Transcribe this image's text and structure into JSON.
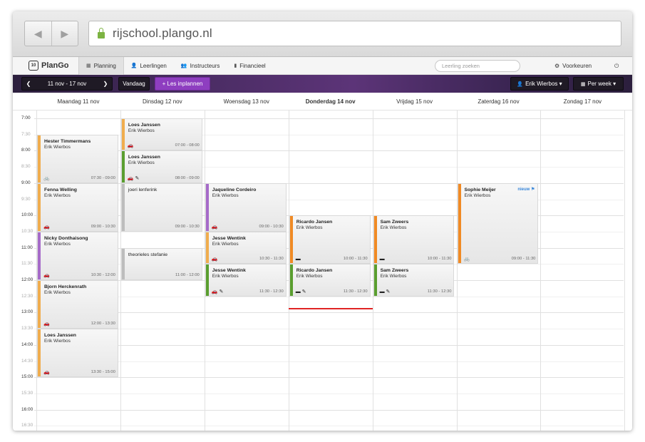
{
  "browser": {
    "url": "rijschool.plango.nl",
    "back_icon": "◀",
    "forward_icon": "▶"
  },
  "app": {
    "logo": "PlanGo",
    "logo_icon_text": "10",
    "nav": [
      {
        "label": "Planning",
        "icon": "calendar-icon",
        "glyph": "▦"
      },
      {
        "label": "Leerlingen",
        "icon": "user-icon",
        "glyph": "👤"
      },
      {
        "label": "Instructeurs",
        "icon": "users-icon",
        "glyph": "👥"
      },
      {
        "label": "Financieel",
        "icon": "document-icon",
        "glyph": "▮"
      }
    ],
    "search_placeholder": "Leerling zoeken",
    "prefs_label": "Voorkeuren",
    "power_icon": "⏻"
  },
  "toolbar": {
    "date_range": "11 nov - 17 nov",
    "prev": "❮",
    "next": "❯",
    "today": "Vandaag",
    "plan_button": "+ Les inplannen",
    "instructor": "Erik Wierbos ▾",
    "view": "Per week ▾",
    "accent": "#8e3ec0"
  },
  "days": [
    "Maandag 11 nov",
    "Dinsdag 12 nov",
    "Woensdag 13 nov",
    "Donderdag 14 nov",
    "Vrijdag 15 nov",
    "Zaterdag 16 nov",
    "Zondag 17 nov"
  ],
  "today_index": 3,
  "times": [
    "7:00",
    "7:30",
    "8:00",
    "8:30",
    "9:00",
    "9:30",
    "10:00",
    "10:30",
    "11:00",
    "11:30",
    "12:00",
    "12:30",
    "13:00",
    "13:30",
    "14:00",
    "14:30",
    "15:00",
    "15:30",
    "16:00",
    "16:30"
  ],
  "events": [
    {
      "day": 0,
      "start": 7.5,
      "end": 9.0,
      "name": "Hester Timmermans",
      "instructor": "Erik Wierbos",
      "time": "07:30 - 09:00",
      "color": "#f0ad4e",
      "icons": "🚲"
    },
    {
      "day": 0,
      "start": 9.0,
      "end": 10.5,
      "name": "Fenna Welling",
      "instructor": "Erik Wierbos",
      "time": "09:00 - 10:30",
      "color": "#f0ad4e",
      "icons": "🚗"
    },
    {
      "day": 0,
      "start": 10.5,
      "end": 12.0,
      "name": "Nicky Donthaisong",
      "instructor": "Erik Wierbos",
      "time": "10:30 - 12:00",
      "color": "#a66bc9",
      "icons": "🚗"
    },
    {
      "day": 0,
      "start": 12.0,
      "end": 13.5,
      "name": "Bjorn Herckenrath",
      "instructor": "Erik Wierbos",
      "time": "12:00 - 13:30",
      "color": "#f0ad4e",
      "icons": "🚗"
    },
    {
      "day": 0,
      "start": 13.5,
      "end": 15.0,
      "name": "Loes Janssen",
      "instructor": "Erik Wierbos",
      "time": "13:30 - 15:00",
      "color": "#f0ad4e",
      "icons": "🚗"
    },
    {
      "day": 1,
      "start": 7.0,
      "end": 8.0,
      "name": "Loes Janssen",
      "instructor": "Erik Wierbos",
      "time": "07:00 - 08:00",
      "color": "#f0ad4e",
      "icons": "🚗"
    },
    {
      "day": 1,
      "start": 8.0,
      "end": 9.0,
      "name": "Loes Janssen",
      "instructor": "Erik Wierbos",
      "time": "08:00 - 09:00",
      "color": "#5a9e2f",
      "icons": "🚗 ✎"
    },
    {
      "day": 1,
      "start": 9.0,
      "end": 10.5,
      "name": "joeri lenferink",
      "instructor": "",
      "time": "09:00 - 10:30",
      "color": "#bdbdbd",
      "icons": "",
      "plain": true
    },
    {
      "day": 1,
      "start": 11.0,
      "end": 12.0,
      "name": "theorieles stefanie",
      "instructor": "",
      "time": "11:00 - 12:00",
      "color": "#bdbdbd",
      "icons": "",
      "plain": true
    },
    {
      "day": 2,
      "start": 9.0,
      "end": 10.5,
      "name": "Jaqueline Cordeiro",
      "instructor": "Erik Wierbos",
      "time": "09:00 - 10:30",
      "color": "#a66bc9",
      "icons": "🚗"
    },
    {
      "day": 2,
      "start": 10.5,
      "end": 11.5,
      "name": "Jesse Wentink",
      "instructor": "Erik Wierbos",
      "time": "10:30 - 11:30",
      "color": "#f0ad4e",
      "icons": "🚗"
    },
    {
      "day": 2,
      "start": 11.5,
      "end": 12.5,
      "name": "Jesse Wentink",
      "instructor": "Erik Wierbos",
      "time": "11:30 - 12:30",
      "color": "#5a9e2f",
      "icons": "🚗 ✎"
    },
    {
      "day": 3,
      "start": 10.0,
      "end": 11.5,
      "name": "Ricardo Jansen",
      "instructor": "Erik Wierbos",
      "time": "10:00 - 11:30",
      "color": "#f08a24",
      "icons": "▬"
    },
    {
      "day": 3,
      "start": 11.5,
      "end": 12.5,
      "name": "Ricardo Jansen",
      "instructor": "Erik Wierbos",
      "time": "11:30 - 12:30",
      "color": "#5a9e2f",
      "icons": "▬ ✎"
    },
    {
      "day": 4,
      "start": 10.0,
      "end": 11.5,
      "name": "Sam Zweers",
      "instructor": "Erik Wierbos",
      "time": "10:00 - 11:30",
      "color": "#f08a24",
      "icons": "▬"
    },
    {
      "day": 4,
      "start": 11.5,
      "end": 12.5,
      "name": "Sam Zweers",
      "instructor": "Erik Wierbos",
      "time": "11:30 - 12:30",
      "color": "#5a9e2f",
      "icons": "▬ ✎"
    },
    {
      "day": 5,
      "start": 9.0,
      "end": 11.5,
      "name": "Sophie Meijer",
      "instructor": "Erik Wierbos",
      "time": "09:00 - 11:30",
      "color": "#f08a24",
      "icons": "🚲",
      "badge": "nieuw ⚑"
    }
  ],
  "now_time": 12.85
}
